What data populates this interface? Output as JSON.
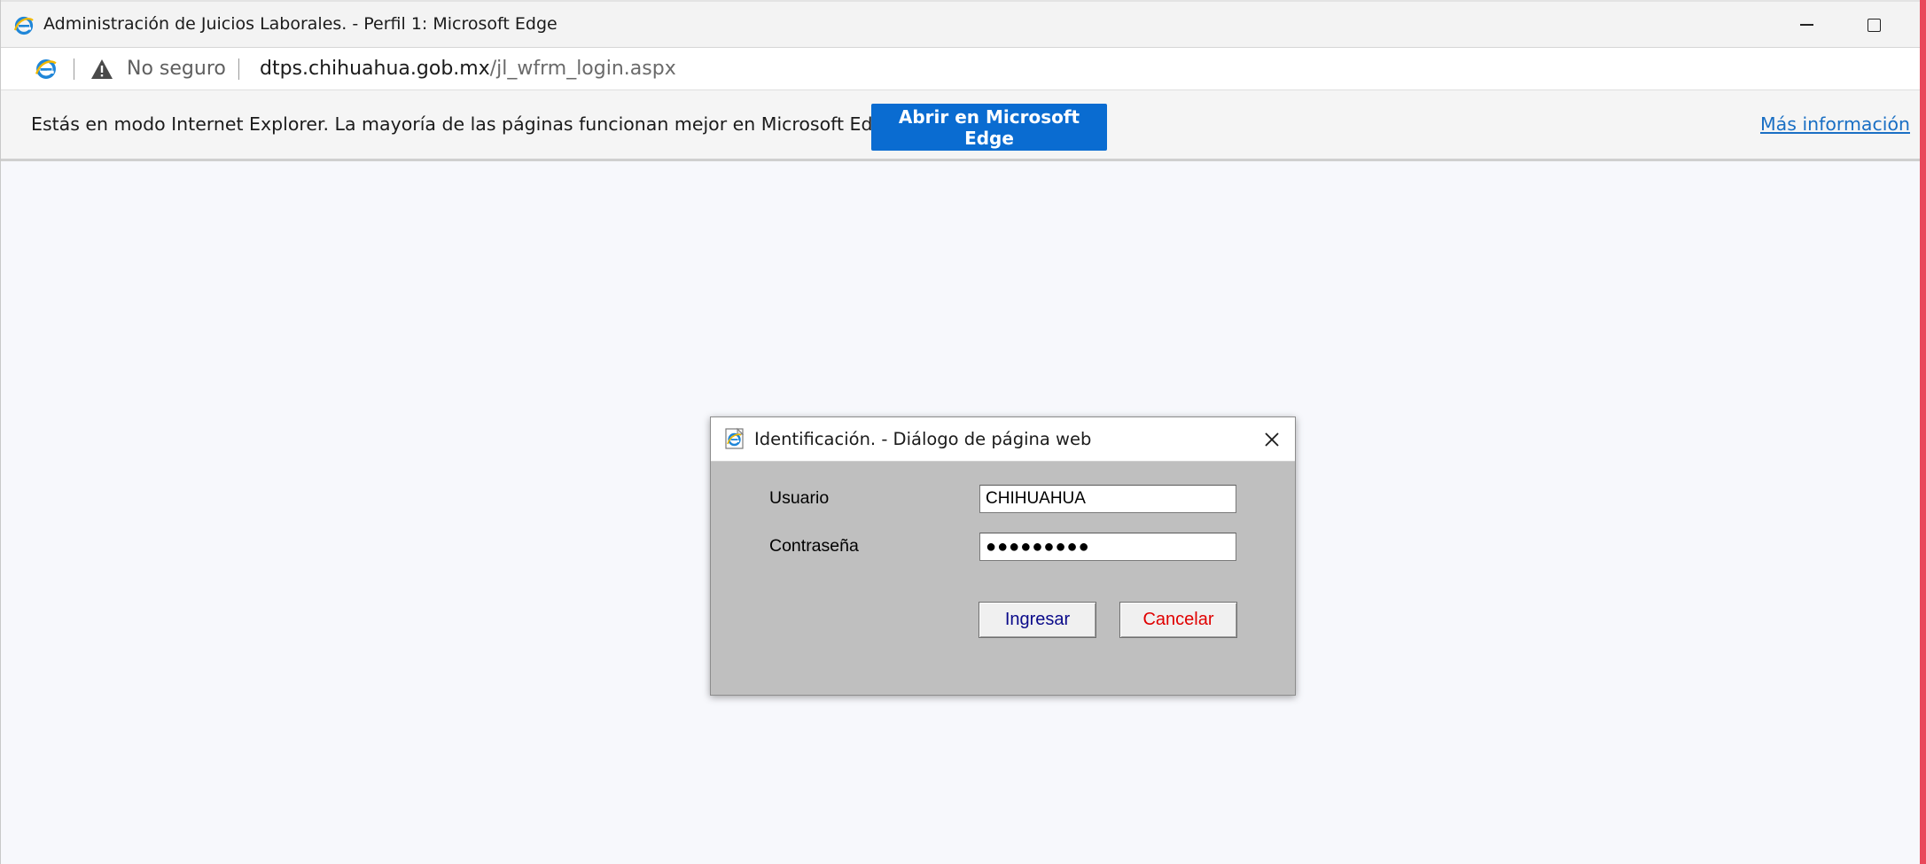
{
  "window": {
    "title": "Administración de Juicios Laborales. - Perfil 1: Microsoft Edge",
    "icon": "ie-icon"
  },
  "address_bar": {
    "security_text": "No seguro",
    "url_host": "dtps.chihuahua.gob.mx",
    "url_path": "/jl_wfrm_login.aspx"
  },
  "info_bar": {
    "message": "Estás en modo Internet Explorer. La mayoría de las páginas funcionan mejor en Microsoft Edge.",
    "button_label": "Abrir en Microsoft Edge",
    "link_label": "Más información"
  },
  "dialog": {
    "title": "Identificación. - Diálogo de página web",
    "user_label": "Usuario",
    "user_value": "CHIHUAHUA",
    "password_label": "Contraseña",
    "password_mask": "●●●●●●●●●",
    "login_label": "Ingresar",
    "cancel_label": "Cancelar"
  },
  "colors": {
    "accent_button": "#0a6cd1",
    "link": "#1a6fc4",
    "dialog_body": "#bfbfbf",
    "login_text": "#0a0a8a",
    "cancel_text": "#e00000",
    "edge_accent": "#e9485a"
  }
}
